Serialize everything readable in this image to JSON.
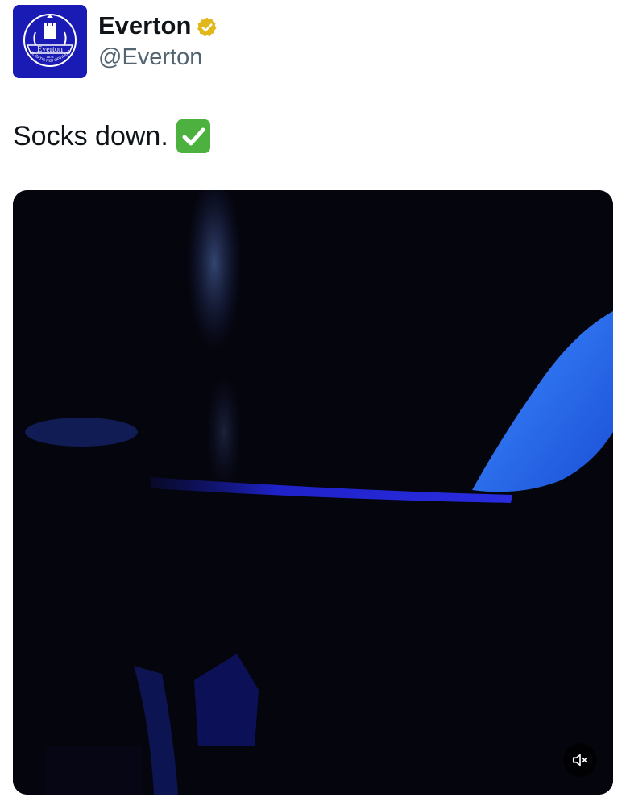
{
  "author": {
    "display_name": "Everton",
    "handle": "@Everton",
    "avatar_icon": "everton-crest-icon",
    "avatar_text": "Everton",
    "avatar_year": "1878",
    "avatar_motto": "NIL SATIS NISI OPTIMUM",
    "verified": true,
    "verified_icon": "verified-gold-badge-icon",
    "brand_color": "#1a1ab4",
    "badge_color": "#e2b719"
  },
  "tweet": {
    "text": "Socks down.",
    "emoji_icon": "check-mark-button-emoji"
  },
  "media": {
    "type": "video",
    "mute_icon": "speaker-muted-icon",
    "muted": true
  }
}
